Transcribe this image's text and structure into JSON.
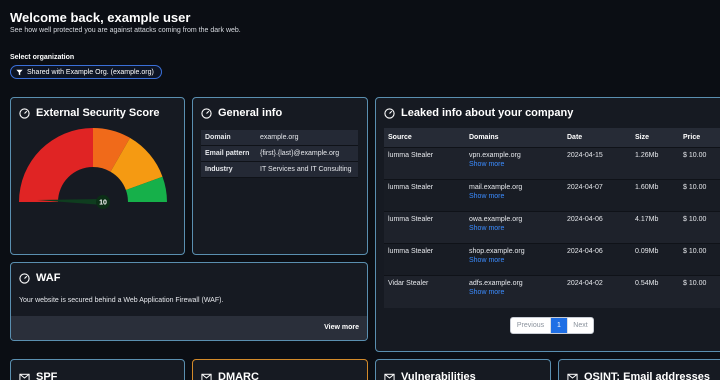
{
  "header": {
    "title": "Welcome back, example user",
    "subtitle": "See how well protected you are against attacks coming from the dark web."
  },
  "organization": {
    "label": "Select organization",
    "selected": "Shared with Example Org. (example.org)"
  },
  "security_score": {
    "title": "External Security Score",
    "value": "10",
    "colors": [
      "#e02424",
      "#f06a1a",
      "#f59a12",
      "#16b04a"
    ]
  },
  "general_info": {
    "title": "General info",
    "rows": [
      {
        "key": "Domain",
        "value": "example.org"
      },
      {
        "key": "Email pattern",
        "value": "{first}.{last}@example.org"
      },
      {
        "key": "Industry",
        "value": "IT Services and IT Consulting"
      }
    ]
  },
  "waf": {
    "title": "WAF",
    "text": "Your website is secured behind a Web Application Firewall (WAF).",
    "view_more": "View more"
  },
  "leaked": {
    "title": "Leaked info about your company",
    "columns": [
      "Source",
      "Domains",
      "Date",
      "Size",
      "Price"
    ],
    "show_more": "Show more",
    "rows": [
      {
        "source": "lumma Stealer",
        "domain": "vpn.example.org",
        "date": "2024-04-15",
        "size": "1.26Mb",
        "price": "$ 10.00"
      },
      {
        "source": "lumma Stealer",
        "domain": "mail.example.org",
        "date": "2024-04-07",
        "size": "1.60Mb",
        "price": "$ 10.00"
      },
      {
        "source": "lumma Stealer",
        "domain": "owa.example.org",
        "date": "2024-04-06",
        "size": "4.17Mb",
        "price": "$ 10.00"
      },
      {
        "source": "lumma Stealer",
        "domain": "shop.example.org",
        "date": "2024-04-06",
        "size": "0.09Mb",
        "price": "$ 10.00"
      },
      {
        "source": "Vidar Stealer",
        "domain": "adfs.example.org",
        "date": "2024-04-02",
        "size": "0.54Mb",
        "price": "$ 10.00"
      }
    ],
    "pager": {
      "previous": "Previous",
      "current": "1",
      "next": "Next"
    }
  },
  "bottom_cards": {
    "spf": "SPF",
    "dmarc": "DMARC",
    "vulnerabilities": "Vulnerabilities",
    "osint": "OSINT: Email addresses"
  }
}
